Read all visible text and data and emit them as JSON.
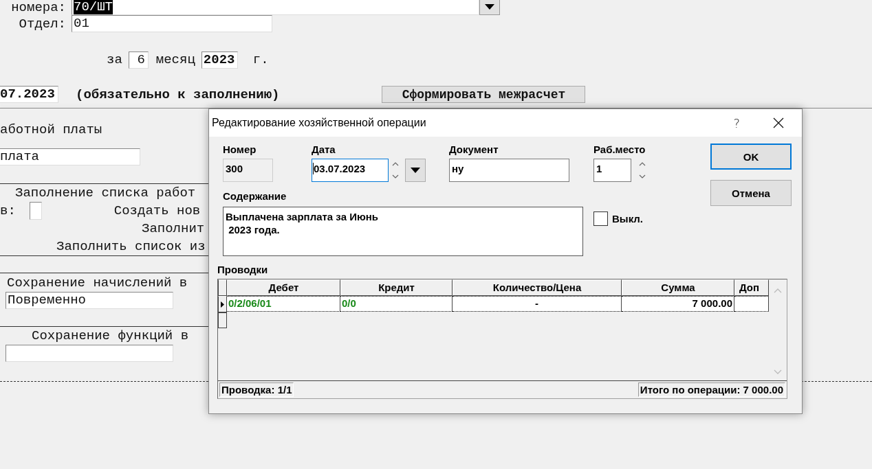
{
  "background_form": {
    "number_label": "номера:",
    "number_value": "70/ШТ",
    "number_value_selected": true,
    "department_label": "Отдел:",
    "department_value": "01",
    "period": {
      "prefix": "за",
      "month": "6",
      "month_label": "месяц",
      "year": "2023",
      "year_suffix": "г."
    },
    "date_value": "07.2023",
    "date_note": "(обязательно к заполнению)",
    "interim_button": "Сформировать межрасчет",
    "salary_label": "аботной платы",
    "salary_value": "плата",
    "fill_section_title": "Заполнение списка работ",
    "checkbox_label": "в:",
    "checkbox_checked": false,
    "create_new": "Создать нов",
    "fill_line_1": "Заполнит",
    "fill_line_2": "Заполнить список из",
    "accruals_title": "Сохранение начислений в",
    "accruals_value": "Повременно",
    "functions_title": "Сохранение функций в"
  },
  "dialog": {
    "title": "Редактирование хозяйственной операции",
    "help": "?",
    "number": {
      "label": "Номер",
      "value": "300"
    },
    "date": {
      "label": "Дата",
      "value": "03.07.2023",
      "focused": true
    },
    "document": {
      "label": "Документ",
      "value": "ну"
    },
    "workplace": {
      "label": "Раб.место",
      "value": "1"
    },
    "content": {
      "label": "Содержание",
      "lines": [
        "Выплачена зарплата за Июнь",
        " 2023 года."
      ]
    },
    "off": {
      "label": "Выкл.",
      "checked": false
    },
    "buttons": [
      {
        "label": "OK",
        "default": true
      },
      {
        "label": "Отмена",
        "default": false
      }
    ],
    "entries": {
      "label": "Проводки",
      "columns": [
        "Дебет",
        "Кредит",
        "Количество/Цена",
        "Сумма",
        "Доп"
      ],
      "rows": [
        {
          "selected": true,
          "debit": "0/2/06/01",
          "credit": "0/0",
          "quantity": "-",
          "sum": "7 000.00"
        }
      ],
      "status_left": "Проводка: 1/1",
      "status_right": "Итого по операции: 7 000.00"
    }
  }
}
